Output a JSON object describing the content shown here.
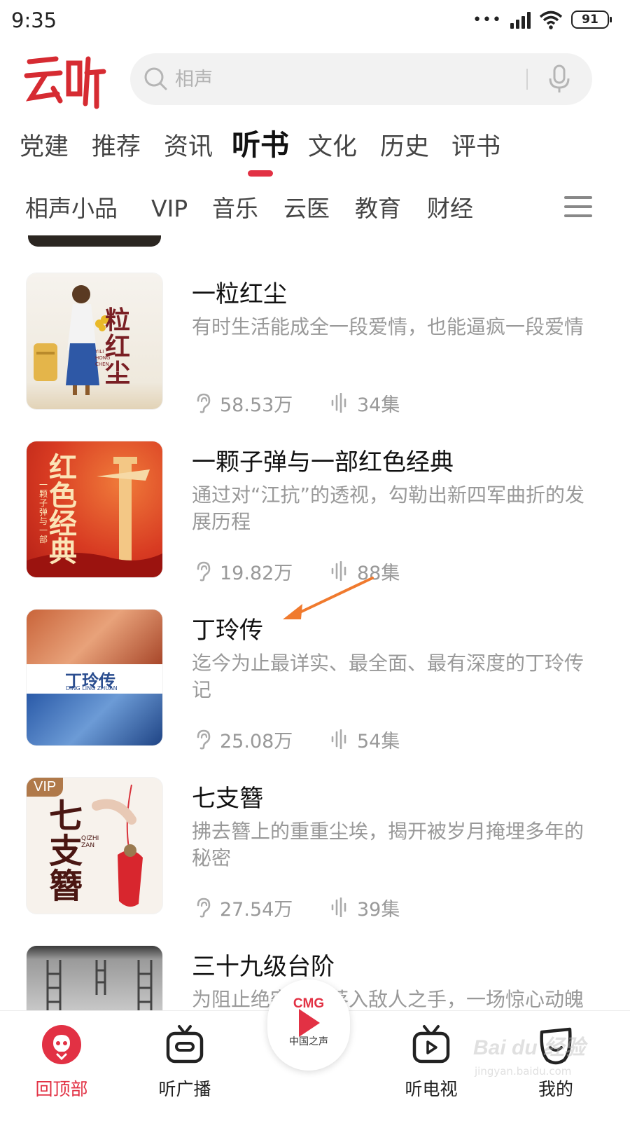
{
  "status_bar": {
    "time": "9:35",
    "battery": "91",
    "dots": "•••"
  },
  "header": {
    "logo_text": "云听",
    "search_placeholder": "相声"
  },
  "primary_tabs": [
    {
      "label": "党建"
    },
    {
      "label": "推荐"
    },
    {
      "label": "资讯"
    },
    {
      "label": "听书",
      "active": true
    },
    {
      "label": "文化"
    },
    {
      "label": "历史"
    },
    {
      "label": "评书"
    }
  ],
  "secondary_tabs": [
    {
      "label": "相声小品"
    },
    {
      "label": "VIP"
    },
    {
      "label": "音乐"
    },
    {
      "label": "云医"
    },
    {
      "label": "教育"
    },
    {
      "label": "财经"
    }
  ],
  "books": [
    {
      "title": "一粒红尘",
      "description": "有时生活能成全一段爱情，也能逼疯一段爱情",
      "plays": "58.53万",
      "episodes": "34集",
      "cover_text": "粒红尘",
      "cover_sub": "YILI HONG CHEN"
    },
    {
      "title": "一颗子弹与一部红色经典",
      "description": "通过对“江抗”的透视，勾勒出新四军曲折的发展历程",
      "plays": "19.82万",
      "episodes": "88集",
      "cover_text": "红色经典",
      "cover_sub": "一颗子弹与一部"
    },
    {
      "title": "丁玲传",
      "description": "迄今为止最详实、最全面、最有深度的丁玲传记",
      "plays": "25.08万",
      "episodes": "54集",
      "cover_text": "丁玲传",
      "cover_sub": "DING LING ZHUAN"
    },
    {
      "title": "七支簪",
      "description": "拂去簪上的重重尘埃，揭开被岁月掩埋多年的秘密",
      "plays": "27.54万",
      "episodes": "39集",
      "cover_text": "七支簪",
      "cover_sub": "QIZHI ZAN",
      "badge": "VIP"
    },
    {
      "title": "三十九级台阶",
      "description": "为阻止绝密情报落入敌人之手，一场惊心动魄"
    }
  ],
  "bottom_nav": {
    "back_to_top": "回顶部",
    "radio": "听广播",
    "center_brand": "CMG",
    "center_label": "中国之声",
    "tv": "听电视",
    "mine": "我的"
  },
  "watermark": {
    "text": "Bai du 经验",
    "sub": "jingyan.baidu.com"
  },
  "colors": {
    "accent": "#e23144",
    "annotation": "#f07a2e"
  }
}
